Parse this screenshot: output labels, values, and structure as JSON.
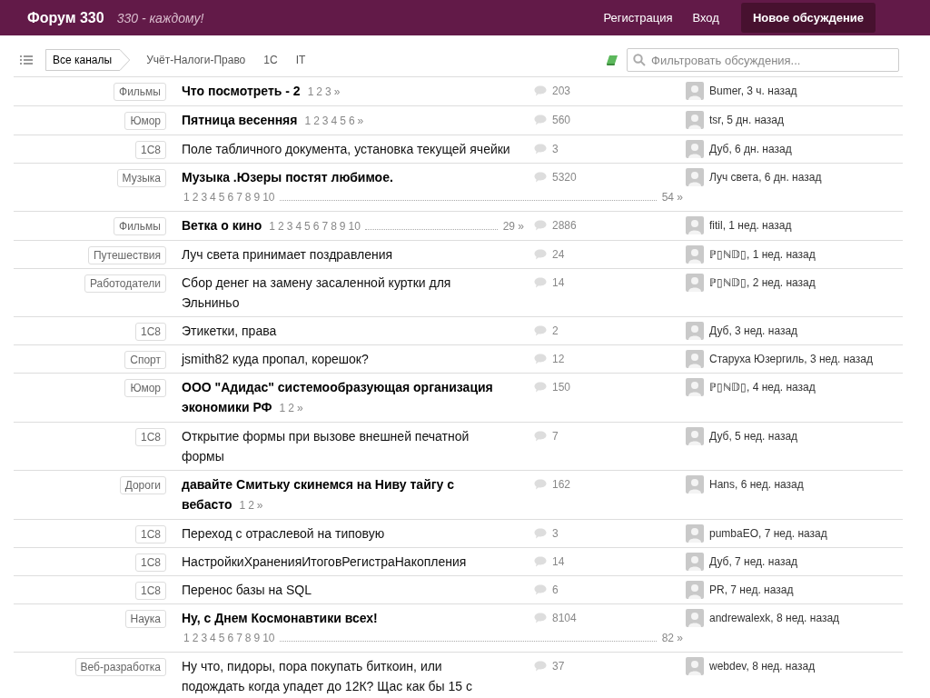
{
  "header": {
    "logo": "Форум 330",
    "tagline": "330 - каждому!",
    "links": [
      "Регистрация",
      "Вход"
    ],
    "new_button": "Новое обсуждение"
  },
  "toolbar": {
    "breadcrumbs": [
      {
        "label": "Все каналы",
        "selected": true
      },
      {
        "label": "Учёт-Налоги-Право",
        "selected": false
      },
      {
        "label": "1С",
        "selected": false
      },
      {
        "label": "IT",
        "selected": false
      }
    ],
    "search": {
      "placeholder": "Фильтровать обсуждения..."
    }
  },
  "topics": [
    {
      "tag": "Фильмы",
      "title_lines": [
        "Что посмотреть - 2"
      ],
      "unread": true,
      "pages": {
        "kind": "inline",
        "numbers": [
          "1",
          "2",
          "3"
        ],
        "gap": false,
        "last": "»"
      },
      "count": "203",
      "last_post": "Bumer, 3 ч. назад"
    },
    {
      "tag": "Юмор",
      "title_lines": [
        "Пятница весенняя"
      ],
      "unread": true,
      "pages": {
        "kind": "inline",
        "numbers": [
          "1",
          "2",
          "3",
          "4",
          "5",
          "6"
        ],
        "gap": false,
        "last": "»"
      },
      "count": "560",
      "last_post": "tsr, 5 дн. назад"
    },
    {
      "tag": "1С8",
      "title_lines": [
        "Поле табличного документа, установка текущей ячейки"
      ],
      "unread": false,
      "count": "3",
      "last_post": "Дуб, 6 дн. назад"
    },
    {
      "tag": "Музыка",
      "title_lines": [
        "Музыка .Юзеры постят любимое."
      ],
      "unread": true,
      "pages": {
        "kind": "below",
        "numbers": [
          "1",
          "2",
          "3",
          "4",
          "5",
          "6",
          "7",
          "8",
          "9",
          "10"
        ],
        "gap": true,
        "last": "54 »"
      },
      "count": "5320",
      "last_post": "Луч света, 6 дн. назад"
    },
    {
      "tag": "Фильмы",
      "title_lines": [
        "Ветка о кино"
      ],
      "unread": true,
      "pages": {
        "kind": "inline",
        "numbers": [
          "1",
          "2",
          "3",
          "4",
          "5",
          "6",
          "7",
          "8",
          "9",
          "10"
        ],
        "gap": true,
        "last": "29 »"
      },
      "count": "2886",
      "last_post": "fitil, 1 нед. назад"
    },
    {
      "tag": "Путешествия",
      "title_lines": [
        "Луч света принимает поздравления"
      ],
      "unread": false,
      "count": "24",
      "last_post": "ℙ▯ℕ𝔻▯, 1 нед. назад"
    },
    {
      "tag": "Работодатели",
      "title_lines": [
        "Сбор денег на замену засаленной куртки для",
        "Эльниньо"
      ],
      "unread": false,
      "count": "14",
      "last_post": "ℙ▯ℕ𝔻▯, 2 нед. назад"
    },
    {
      "tag": "1С8",
      "title_lines": [
        "Этикетки, права"
      ],
      "unread": false,
      "count": "2",
      "last_post": "Дуб, 3 нед. назад"
    },
    {
      "tag": "Спорт",
      "title_lines": [
        "jsmith82 куда пропал, корешок?"
      ],
      "unread": false,
      "count": "12",
      "last_post": "Старуха Юзергиль, 3 нед. назад"
    },
    {
      "tag": "Юмор",
      "title_lines": [
        "ООО \"Адидас\" системообразующая организация",
        "экономики РФ"
      ],
      "unread": true,
      "pages": {
        "kind": "inline",
        "numbers": [
          "1",
          "2"
        ],
        "gap": false,
        "last": "»"
      },
      "count": "150",
      "last_post": "ℙ▯ℕ𝔻▯, 4 нед. назад"
    },
    {
      "tag": "1С8",
      "title_lines": [
        "Открытие формы при вызове внешней печатной",
        "формы"
      ],
      "unread": false,
      "count": "7",
      "last_post": "Дуб, 5 нед. назад"
    },
    {
      "tag": "Дороги",
      "title_lines": [
        "давайте Смитьку скинемся на Ниву тайгу с",
        "вебасто"
      ],
      "unread": true,
      "pages": {
        "kind": "inline",
        "numbers": [
          "1",
          "2"
        ],
        "gap": false,
        "last": "»"
      },
      "count": "162",
      "last_post": "Hans, 6 нед. назад"
    },
    {
      "tag": "1С8",
      "title_lines": [
        "Переход с отраслевой на типовую"
      ],
      "unread": false,
      "count": "3",
      "last_post": "pumbaEO, 7 нед. назад"
    },
    {
      "tag": "1С8",
      "title_lines": [
        "НастройкиХраненияИтоговРегистраНакопления"
      ],
      "unread": false,
      "count": "14",
      "last_post": "Дуб, 7 нед. назад"
    },
    {
      "tag": "1С8",
      "title_lines": [
        "Перенос базы на SQL"
      ],
      "unread": false,
      "count": "6",
      "last_post": "PR, 7 нед. назад"
    },
    {
      "tag": "Наука",
      "title_lines": [
        "Ну, с Днем Космонавтики всех!"
      ],
      "unread": true,
      "pages": {
        "kind": "below",
        "numbers": [
          "1",
          "2",
          "3",
          "4",
          "5",
          "6",
          "7",
          "8",
          "9",
          "10"
        ],
        "gap": true,
        "last": "82 »"
      },
      "count": "8104",
      "last_post": "andrewalexk, 8 нед. назад"
    },
    {
      "tag": "Веб-разработка",
      "title_lines": [
        "Ну что, пидоры, пора покупать биткоин, или",
        "подождать когда упадет до 12К? Щас как бы 15 с"
      ],
      "unread": false,
      "count": "37",
      "last_post": "webdev, 8 нед. назад"
    }
  ]
}
